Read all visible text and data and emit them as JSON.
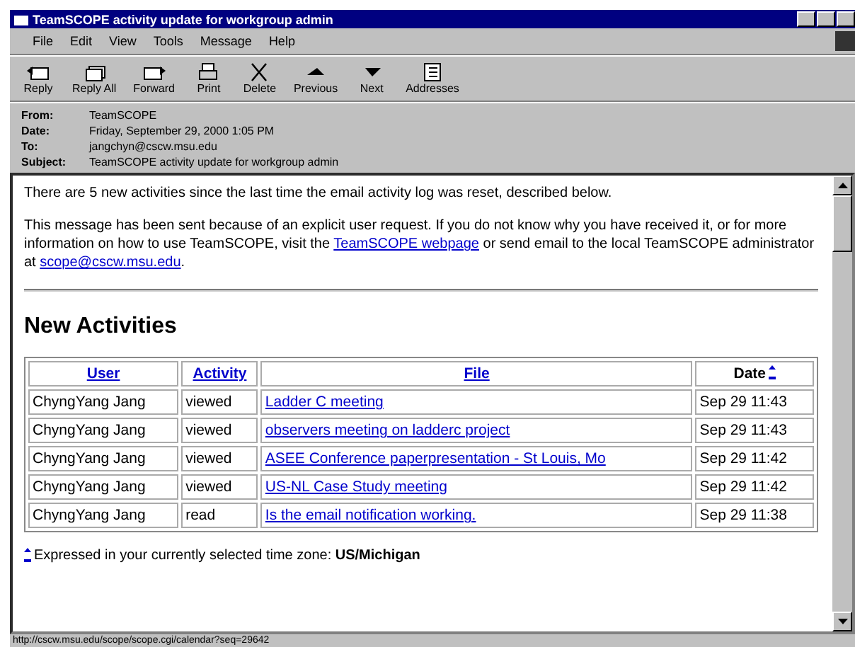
{
  "window": {
    "title": "TeamSCOPE activity update for workgroup admin"
  },
  "menu": [
    "File",
    "Edit",
    "View",
    "Tools",
    "Message",
    "Help"
  ],
  "toolbar": [
    {
      "label": "Reply",
      "kind": "reply"
    },
    {
      "label": "Reply All",
      "kind": "replyall"
    },
    {
      "label": "Forward",
      "kind": "forward"
    },
    {
      "label": "Print",
      "kind": "print"
    },
    {
      "label": "Delete",
      "kind": "delete"
    },
    {
      "label": "Previous",
      "kind": "previous"
    },
    {
      "label": "Next",
      "kind": "next"
    },
    {
      "label": "Addresses",
      "kind": "addresses"
    }
  ],
  "headers": [
    {
      "label": "From:",
      "value": "TeamSCOPE"
    },
    {
      "label": "Date:",
      "value": "Friday, September 29, 2000 1:05 PM"
    },
    {
      "label": "To:",
      "value": "jangchyn@cscw.msu.edu"
    },
    {
      "label": "Subject:",
      "value": "TeamSCOPE activity update for workgroup admin"
    }
  ],
  "intro": "There are 5 new activities since the last time the email activity log was reset, described below.",
  "notice": [
    {
      "kind": "text",
      "text": "This message has been sent because of an explicit user request. If you do not know why you have received it, or for more information on how to use TeamSCOPE, visit the "
    },
    {
      "kind": "link",
      "text": "TeamSCOPE webpage"
    },
    {
      "kind": "text",
      "text": " or send email to the local TeamSCOPE administrator at "
    },
    {
      "kind": "link",
      "text": "scope@cscw.msu.edu"
    },
    {
      "kind": "text",
      "text": "."
    }
  ],
  "heading": "New Activities",
  "table": {
    "columns": [
      {
        "label": "User",
        "link": true,
        "sorted": false
      },
      {
        "label": "Activity",
        "link": true,
        "sorted": false
      },
      {
        "label": "File",
        "link": true,
        "sorted": false
      },
      {
        "label": "Date",
        "link": false,
        "sorted": true
      }
    ],
    "rows": [
      [
        "ChyngYang Jang",
        "viewed",
        "Ladder C meeting",
        "Sep 29 11:43"
      ],
      [
        "ChyngYang Jang",
        "viewed",
        "observers meeting on ladderc project",
        "Sep 29 11:43"
      ],
      [
        "ChyngYang Jang",
        "viewed",
        "ASEE Conference paperpresentation - St Louis, Mo",
        "Sep 29 11:42"
      ],
      [
        "ChyngYang Jang",
        "viewed",
        "US-NL Case Study meeting",
        "Sep 29 11:42"
      ],
      [
        "ChyngYang Jang",
        "read",
        "Is the email notification working.",
        "Sep 29 11:38"
      ]
    ]
  },
  "footnote": {
    "text": "Expressed in your currently selected time zone: ",
    "zone": "US/Michigan"
  },
  "status_bar": "http://cscw.msu.edu/scope/scope.cgi/calendar?seq=29642"
}
